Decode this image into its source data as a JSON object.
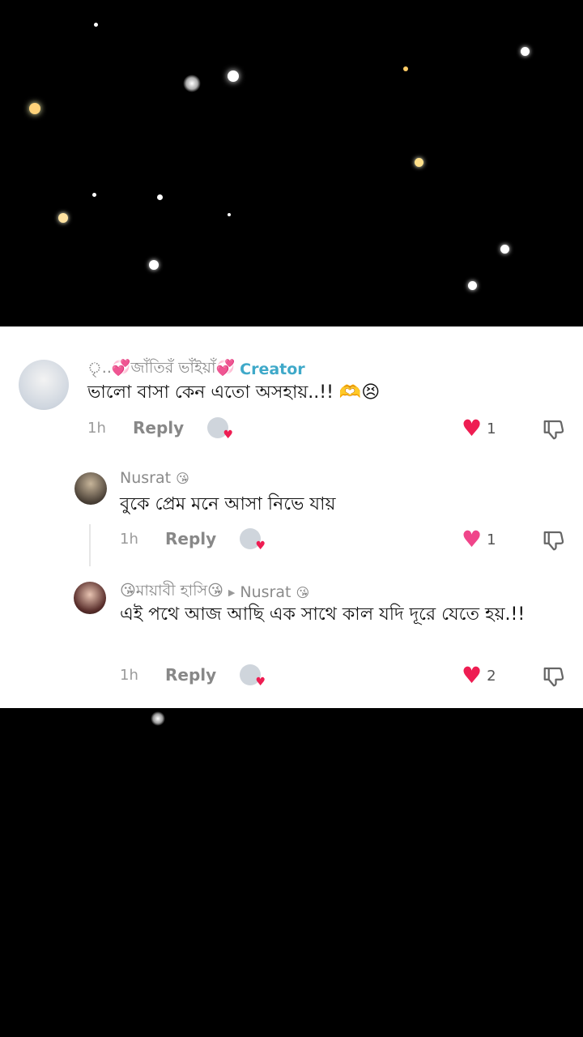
{
  "comments": [
    {
      "author": "ৃ..💞জাঁতিরঁ ভাঁইয়াঁ💞",
      "badge": "Creator",
      "text": "ভালো বাসা কেন এতো অসহায়..!! 🫶😣",
      "time": "1h",
      "reply_label": "Reply",
      "likes": "1"
    },
    {
      "author": "Nusrat",
      "author_emoji": "😘",
      "text": "বুকে প্রেম মনে আসা নিভে যায়",
      "time": "1h",
      "reply_label": "Reply",
      "likes": "1"
    },
    {
      "author": "😘মায়াবী হাসি😘",
      "reply_to": "Nusrat",
      "reply_to_emoji": "😘",
      "text": "এই পথে আজ আছি এক সাথে কাল যদি দূরে যেতে হয়.!!",
      "time": "1h",
      "reply_label": "Reply",
      "likes": "2"
    }
  ],
  "colors": {
    "accent": "#ee1d52",
    "creator": "#3fa9c9"
  },
  "icons": {
    "like": "heart-icon",
    "dislike": "thumbs-down-icon",
    "reply_arrow": "triangle-right-icon"
  }
}
